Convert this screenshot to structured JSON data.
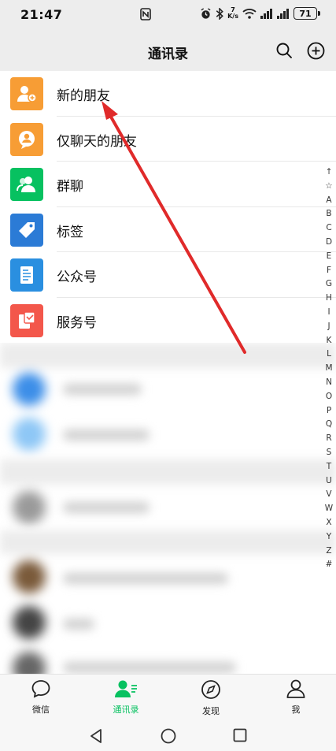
{
  "status_bar": {
    "time": "21:47",
    "speed_top": "7",
    "speed_unit": "K/s",
    "battery": "71"
  },
  "header": {
    "title": "通讯录",
    "search_icon": "search-icon",
    "add_icon": "plus-circle-icon"
  },
  "menu_items": [
    {
      "label": "新的朋友",
      "icon": "add-friend-icon",
      "color": "#f79d35"
    },
    {
      "label": "仅聊天的朋友",
      "icon": "chat-only-friend-icon",
      "color": "#f79d35"
    },
    {
      "label": "群聊",
      "icon": "group-chat-icon",
      "color": "#07c160"
    },
    {
      "label": "标签",
      "icon": "tag-icon",
      "color": "#2b7bd6"
    },
    {
      "label": "公众号",
      "icon": "official-account-icon",
      "color": "#2a8fe0"
    },
    {
      "label": "服务号",
      "icon": "service-account-icon",
      "color": "#f3574b"
    }
  ],
  "index_letters": [
    "↑",
    "☆",
    "A",
    "B",
    "C",
    "D",
    "E",
    "F",
    "G",
    "H",
    "I",
    "J",
    "K",
    "L",
    "M",
    "N",
    "O",
    "P",
    "Q",
    "R",
    "S",
    "T",
    "U",
    "V",
    "W",
    "X",
    "Y",
    "Z",
    "#"
  ],
  "bottom_nav": [
    {
      "label": "微信",
      "icon": "chat-bubble-icon",
      "active": false
    },
    {
      "label": "通讯录",
      "icon": "contacts-icon",
      "active": true
    },
    {
      "label": "发现",
      "icon": "compass-icon",
      "active": false
    },
    {
      "label": "我",
      "icon": "person-icon",
      "active": false
    }
  ],
  "colors": {
    "accent_green": "#07c160",
    "annotation_arrow": "#e02a2a"
  }
}
